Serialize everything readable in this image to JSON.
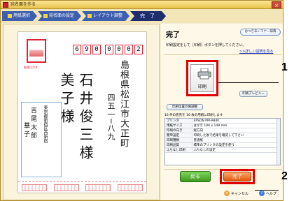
{
  "window": {
    "title": "宛名面を作る",
    "close_label": "×"
  },
  "steps": [
    {
      "label": "用紙選択"
    },
    {
      "label": "宛名面の設定"
    },
    {
      "label": "レイアウト調整"
    },
    {
      "label": "完　了"
    }
  ],
  "card": {
    "stamp_label": "郵便はがき",
    "postal_digits": [
      "6",
      "9",
      "0",
      "0",
      "0",
      "0",
      "2"
    ],
    "recipient_address_1": "島根県松江市大正町",
    "recipient_address_2": "四五一─八九",
    "recipient_name_1": "石井俊三様",
    "recipient_name_2": "美子様",
    "sender_address": "東京都新宿区西新宿",
    "sender_name_1": "吉尾太郎",
    "sender_name_2": "華子"
  },
  "main": {
    "title": "完了",
    "manner_button": "おつきあいマナー辞典",
    "instruction": "印刷設定をして［印刷］ボタンを押してください。",
    "detail_link": ">>詳しい説明を見る",
    "print_button": "印刷",
    "preview_button": "印刷プレビュー",
    "position_button": "印刷位置の微調整",
    "summary": "16 件の宛先を 16 枚の用紙に印刷します",
    "settings": [
      {
        "key": "プリンタ",
        "value": "EPSON PM-A840"
      },
      {
        "key": "用紙サイズ",
        "value": "はがき 100 x 148 mm"
      },
      {
        "key": "印刷の向き",
        "value": "縦方向"
      },
      {
        "key": "簡単設定",
        "value": "印刷した後で結果を確認して下さい"
      },
      {
        "key": "印刷種類",
        "value": "普通紙"
      },
      {
        "key": "印刷品質",
        "value": "標準のプリンタの設定を使う"
      },
      {
        "key": "ふちなし印刷",
        "value": "ふちなしの設定"
      }
    ],
    "back_button": "戻る",
    "done_button": "完了",
    "cancel_button": "キャンセル",
    "help_button": "ヘルプ"
  },
  "callouts": {
    "one": "1",
    "two": "2"
  },
  "colors": {
    "step_bg": "#3e5fb0",
    "step_active": "#1d2d6e",
    "highlight": "#e00000",
    "back_green": "#3e9a1e",
    "done_orange": "#e2550f"
  }
}
